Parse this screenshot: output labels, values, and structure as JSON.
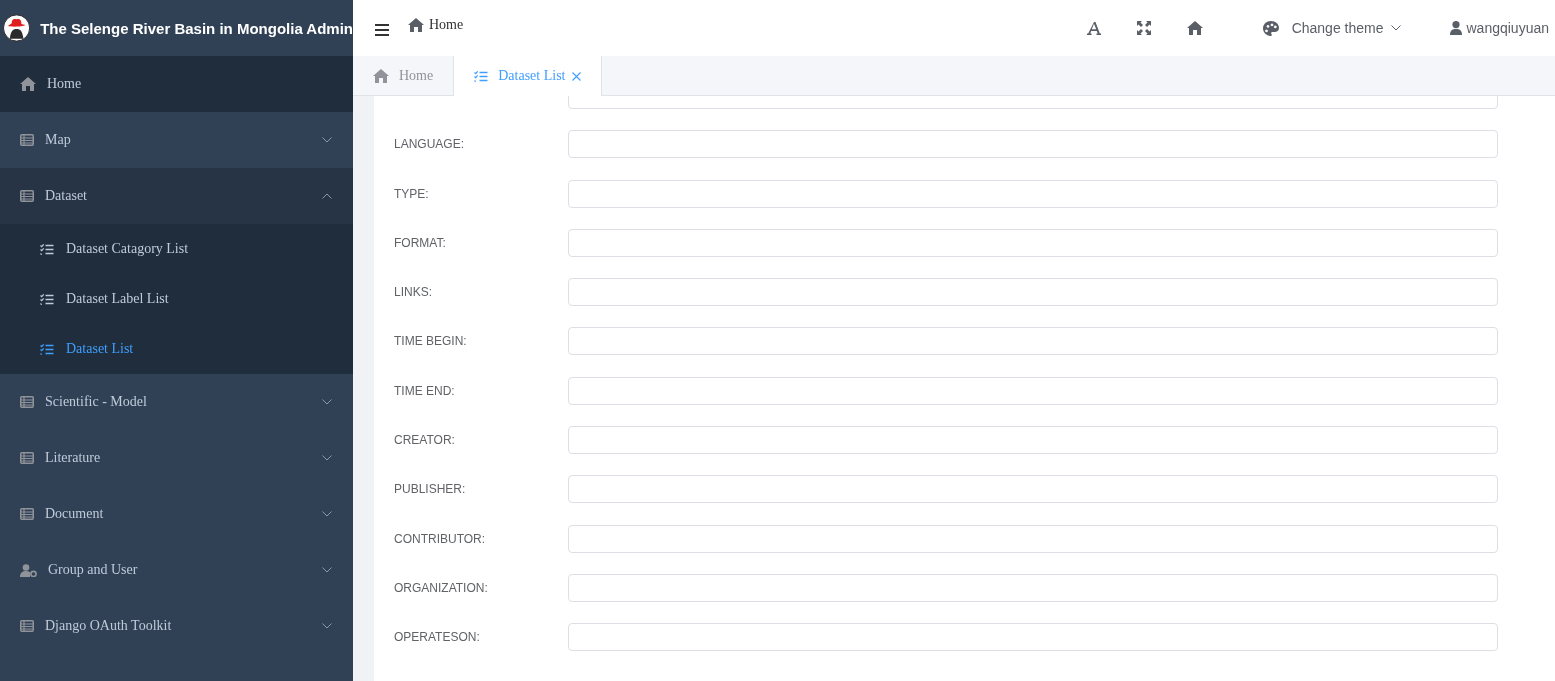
{
  "sidebar": {
    "title": "The Selenge River Basin in Mongolia Admin",
    "items": [
      {
        "label": "Home",
        "kind": "link"
      },
      {
        "label": "Map",
        "kind": "submenu",
        "expanded": false
      },
      {
        "label": "Dataset",
        "kind": "submenu",
        "expanded": true,
        "children": [
          {
            "label": "Dataset Catagory List",
            "selected": false
          },
          {
            "label": "Dataset Label List",
            "selected": false
          },
          {
            "label": "Dataset List",
            "selected": true
          }
        ]
      },
      {
        "label": "Scientific - Model",
        "kind": "submenu",
        "expanded": false
      },
      {
        "label": "Literature",
        "kind": "submenu",
        "expanded": false
      },
      {
        "label": "Document",
        "kind": "submenu",
        "expanded": false
      },
      {
        "label": "Group and User",
        "kind": "submenu",
        "expanded": false
      },
      {
        "label": "Django OAuth Toolkit",
        "kind": "submenu",
        "expanded": false
      }
    ]
  },
  "navbar": {
    "breadcrumb": "Home",
    "theme": "Change theme",
    "user": "wangqiuyuan"
  },
  "tabs": [
    {
      "label": "Home",
      "selected": false
    },
    {
      "label": "Dataset List",
      "selected": true
    }
  ],
  "form": {
    "fields": [
      {
        "kind": "text"
      },
      {
        "label": "LANGUAGE:",
        "kind": "text"
      },
      {
        "label": "TYPE:",
        "kind": "text"
      },
      {
        "label": "FORMAT:",
        "kind": "text"
      },
      {
        "label": "LINKS:",
        "kind": "text"
      },
      {
        "label": "TIME BEGIN:",
        "kind": "text"
      },
      {
        "label": "TIME END:",
        "kind": "text"
      },
      {
        "label": "CREATOR:",
        "kind": "text"
      },
      {
        "label": "PUBLISHER:",
        "kind": "text"
      },
      {
        "label": "CONTRIBUTOR:",
        "kind": "text"
      },
      {
        "label": "ORGANIZATION:",
        "kind": "text"
      },
      {
        "label": "OPERATESON:",
        "kind": "text"
      }
    ]
  }
}
